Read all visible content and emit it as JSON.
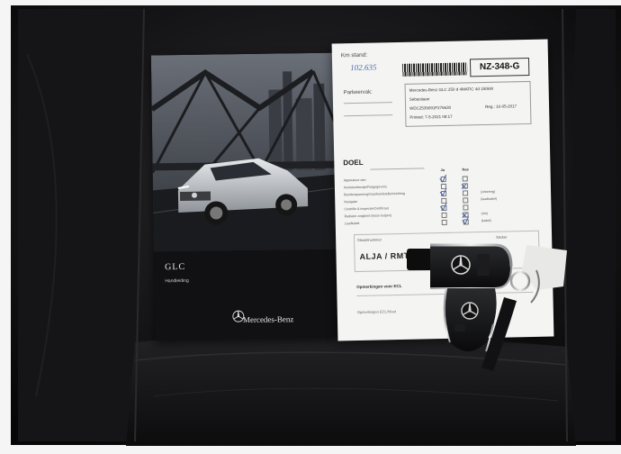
{
  "booklet": {
    "model": "GLC",
    "subtitle": "Handleiding",
    "brand": "Mercedes-Benz"
  },
  "document": {
    "km_label": "Km stand:",
    "km_value": "102.635",
    "parking_label": "Parkeervak:",
    "plate": "NZ-348-G",
    "info_lines": [
      "Mercedes-Benz GLC 250 d 4MATIC 4d 150kW",
      "Sebastiaan",
      "WDC2539091F276630",
      "Printed: 7-5-2021 08:17"
    ],
    "reg_label": "Reg.: 10-05-2017",
    "doel_heading": "DOEL",
    "columns": [
      "Ja",
      "Nee"
    ],
    "checklist": [
      "Apparatuur aan",
      "Kentekenbewijs/Pasgegevens",
      "Bandenspanning/Gaarbandstellerinrichting",
      "Navigatie",
      "Contrôle & inspectie/Certificaat",
      "Radiator zorgbord (losse hulpen)",
      "Laadkabel"
    ],
    "side_options": [
      "(zekering)",
      "(laadkabel)",
      "(rim)",
      "(kabel)"
    ],
    "box_labels": [
      "Sleutelnummer",
      "Sticker"
    ],
    "code": "ALJA / RMT",
    "opmerkingen": "Opmerkingen voor ECL",
    "opmerkingen_sub": "Opmerkingen ECL/Vloot"
  },
  "colors": {
    "seat": "#0b0b0c",
    "paper": "#f4f4f2",
    "ink_blue": "#4a6bb0",
    "booklet": "#111114"
  }
}
